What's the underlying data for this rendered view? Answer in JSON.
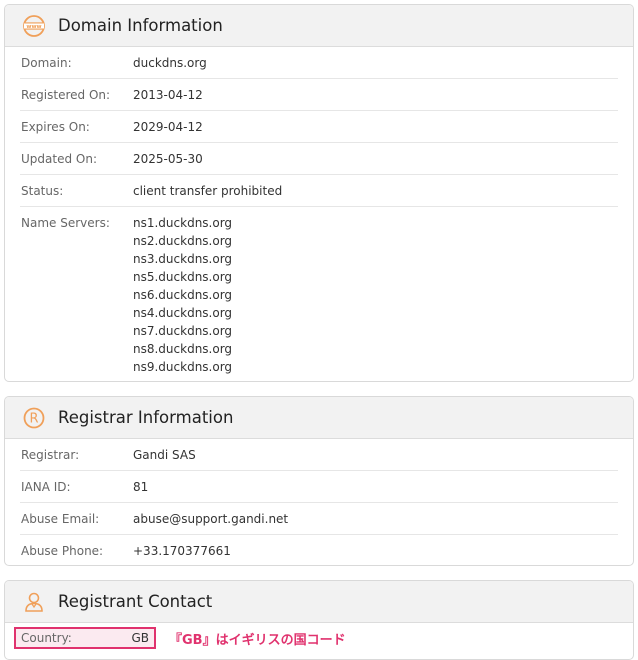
{
  "domain_info": {
    "title": "Domain Information",
    "icon": "www-globe-icon",
    "rows": {
      "domain": {
        "label": "Domain:",
        "value": "duckdns.org"
      },
      "registered": {
        "label": "Registered On:",
        "value": "2013-04-12"
      },
      "expires": {
        "label": "Expires On:",
        "value": "2029-04-12"
      },
      "updated": {
        "label": "Updated On:",
        "value": "2025-05-30"
      },
      "status": {
        "label": "Status:",
        "value": "client transfer prohibited"
      },
      "name_servers": {
        "label": "Name Servers:",
        "values": [
          "ns1.duckdns.org",
          "ns2.duckdns.org",
          "ns3.duckdns.org",
          "ns5.duckdns.org",
          "ns6.duckdns.org",
          "ns4.duckdns.org",
          "ns7.duckdns.org",
          "ns8.duckdns.org",
          "ns9.duckdns.org"
        ]
      }
    }
  },
  "registrar_info": {
    "title": "Registrar Information",
    "icon": "registered-trademark-icon",
    "rows": {
      "registrar": {
        "label": "Registrar:",
        "value": "Gandi SAS"
      },
      "iana": {
        "label": "IANA ID:",
        "value": "81"
      },
      "abuse_email": {
        "label": "Abuse Email:",
        "value": "abuse@support.gandi.net"
      },
      "abuse_phone": {
        "label": "Abuse Phone:",
        "value": "+33.170377661"
      }
    }
  },
  "registrant_contact": {
    "title": "Registrant Contact",
    "icon": "person-icon",
    "country": {
      "label": "Country:",
      "value": "GB"
    },
    "annotation": "『GB』はイギリスの国コード"
  },
  "colors": {
    "accent": "#f0a05a",
    "highlight": "#e0326e"
  }
}
